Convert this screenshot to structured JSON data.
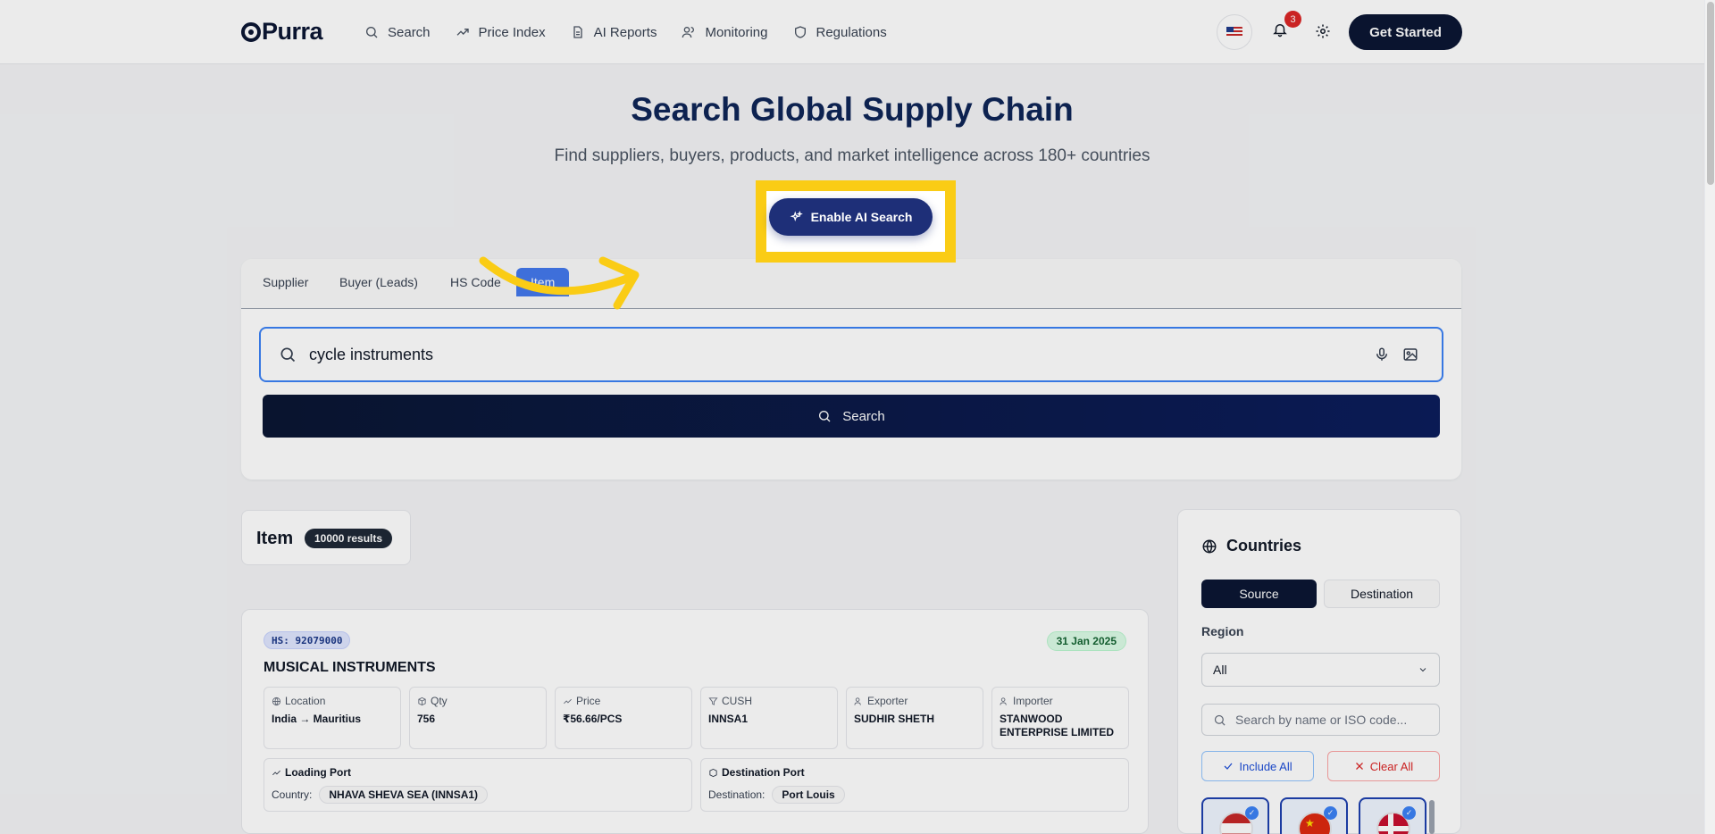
{
  "header": {
    "logo": "Purra",
    "nav": [
      {
        "label": "Search",
        "icon": "search-icon"
      },
      {
        "label": "Price Index",
        "icon": "trending-up-icon"
      },
      {
        "label": "AI Reports",
        "icon": "file-text-icon"
      },
      {
        "label": "Monitoring",
        "icon": "users-icon"
      },
      {
        "label": "Regulations",
        "icon": "shield-icon"
      }
    ],
    "notification_count": "3",
    "get_started": "Get Started"
  },
  "hero": {
    "title": "Search Global Supply Chain",
    "subtitle": "Find suppliers, buyers, products, and market intelligence across 180+ countries",
    "ai_button": "Enable AI Search"
  },
  "search": {
    "tabs": [
      "Supplier",
      "Buyer (Leads)",
      "HS Code",
      "Item"
    ],
    "active_tab": "Item",
    "query": "cycle instruments",
    "button": "Search"
  },
  "results": {
    "title": "Item",
    "count": "10000 results"
  },
  "result_card": {
    "hs": "HS: 92079000",
    "date": "31 Jan 2025",
    "name": "MUSICAL INSTRUMENTS",
    "fields": [
      {
        "label": "Location",
        "value": "India → Mauritius",
        "icon": "globe-icon"
      },
      {
        "label": "Qty",
        "value": "756",
        "icon": "package-icon"
      },
      {
        "label": "Price",
        "value": "₹56.66/PCS",
        "icon": "trending-up-icon"
      },
      {
        "label": "CUSH",
        "value": "INNSA1",
        "icon": "filter-icon"
      },
      {
        "label": "Exporter",
        "value": "SUDHIR SHETH",
        "icon": "users-icon"
      },
      {
        "label": "Importer",
        "value": "STANWOOD ENTERPRISE LIMITED",
        "icon": "users-icon"
      }
    ],
    "loading_port": {
      "label": "Loading Port",
      "row_label": "Country:",
      "value": "NHAVA SHEVA SEA (INNSA1)"
    },
    "destination_port": {
      "label": "Destination Port",
      "row_label": "Destination:",
      "value": "Port Louis"
    }
  },
  "countries": {
    "title": "Countries",
    "source": "Source",
    "destination": "Destination",
    "region_label": "Region",
    "region_value": "All",
    "search_placeholder": "Search by name or ISO code...",
    "include_all": "Include All",
    "clear_all": "Clear All"
  },
  "colors": {
    "primary": "#0b1634",
    "accent": "#2563eb",
    "highlight": "#facc15"
  }
}
